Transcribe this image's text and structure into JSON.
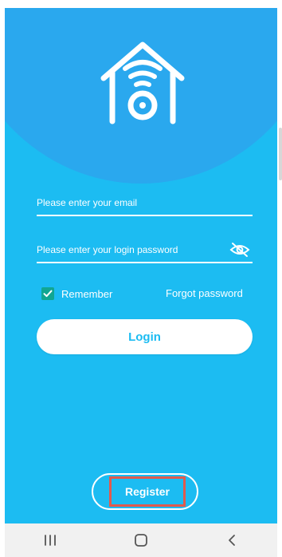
{
  "form": {
    "email_placeholder": "Please enter your email",
    "password_placeholder": "Please enter your login password",
    "remember_label": "Remember",
    "remember_checked": true,
    "forgot_label": "Forgot password",
    "login_label": "Login",
    "register_label": "Register"
  },
  "icons": {
    "logo": "home-wifi-camera-icon",
    "password_visibility": "eye-slash-icon",
    "checkbox": "check-icon",
    "nav_recents": "recents-icon",
    "nav_home": "home-icon",
    "nav_back": "back-icon"
  },
  "colors": {
    "background": "#1cbcf2",
    "header_background": "#2aa8ee",
    "text": "#ffffff",
    "checkbox": "#11a692",
    "highlight": "#e25a4d",
    "nav_bar": "#f1f1f1"
  }
}
